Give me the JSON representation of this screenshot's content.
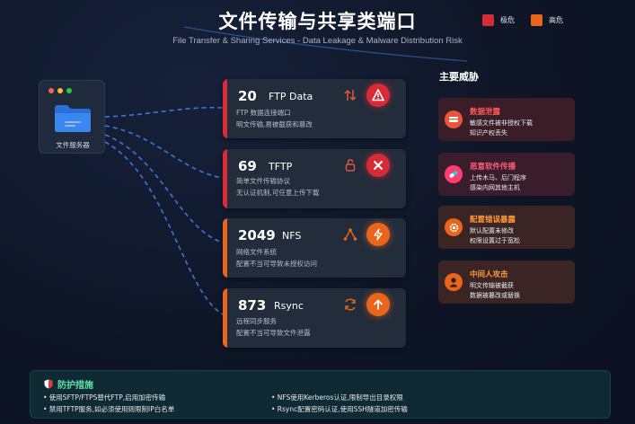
{
  "header": {
    "title": "文件传输与共享类端口",
    "subtitle": "File Transfer & Sharing Services - Data Leakage & Malware Distribution Risk"
  },
  "legend": [
    {
      "label": "极危",
      "color": "#d92b35"
    },
    {
      "label": "高危",
      "color": "#e8651b"
    }
  ],
  "server": {
    "label": "文件服务器"
  },
  "ports": [
    {
      "number": "20",
      "name": "FTP Data",
      "desc1": "FTP 数据连接端口",
      "desc2": "明文传输,易被截获和篡改",
      "severity_color": "#d92b35",
      "side_icon": "transfer-arrows-icon",
      "badge_icon": "warning-icon"
    },
    {
      "number": "69",
      "name": "TFTP",
      "desc1": "简单文件传输协议",
      "desc2": "无认证机制,可任意上传下载",
      "severity_color": "#d92b35",
      "side_icon": "unlock-icon",
      "badge_icon": "cross-icon"
    },
    {
      "number": "2049",
      "name": "NFS",
      "desc1": "网络文件系统",
      "desc2": "配置不当可导致未授权访问",
      "severity_color": "#e8651b",
      "side_icon": "network-icon",
      "badge_icon": "lightning-icon"
    },
    {
      "number": "873",
      "name": "Rsync",
      "desc1": "远程同步服务",
      "desc2": "配置不当可导致文件泄露",
      "severity_color": "#e8651b",
      "side_icon": "sync-icon",
      "badge_icon": "arrow-up-icon"
    }
  ],
  "threats": {
    "title": "主要威胁",
    "items": [
      {
        "title": "数据泄露",
        "desc1": "敏感文件被非授权下载",
        "desc2": "知识产权丢失",
        "color": "#ff5a5a",
        "icon": "data-leak-icon"
      },
      {
        "title": "恶意软件传播",
        "desc1": "上传木马、后门程序",
        "desc2": "感染内网其他主机",
        "color": "#ff5a7a",
        "icon": "malware-icon"
      },
      {
        "title": "配置错误暴露",
        "desc1": "默认配置未修改",
        "desc2": "权限设置过于宽松",
        "color": "#ff9a3c",
        "icon": "gear-icon"
      },
      {
        "title": "中间人攻击",
        "desc1": "明文传输被截获",
        "desc2": "数据被篡改或替换",
        "color": "#ff9a3c",
        "icon": "attacker-icon"
      }
    ]
  },
  "defense": {
    "title": "防护措施",
    "items": [
      "• 使用SFTP/FTPS替代FTP,启用加密传输",
      "• 禁用TFTP服务,如必须使用则限制IP白名单",
      "• NFS使用Kerberos认证,限制导出目录权限",
      "• Rsync配置密码认证,使用SSH隧道加密传输"
    ]
  }
}
